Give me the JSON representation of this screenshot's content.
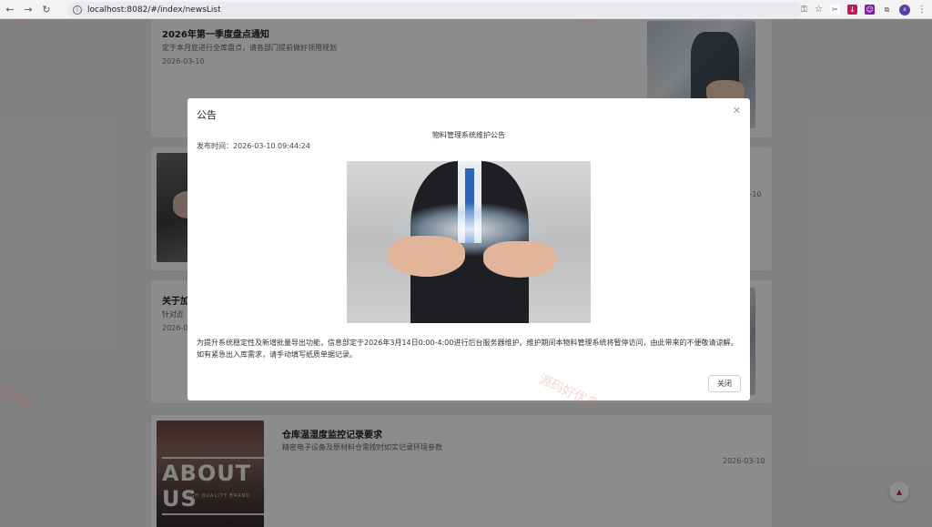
{
  "browser": {
    "url": "localhost:8082/#/index/newsList",
    "profile_initial": "x"
  },
  "news": [
    {
      "title": "2026年第一季度盘点通知",
      "desc": "定于本月底进行全库盘点，请各部门提前做好领用规划",
      "date": "2026-03-10"
    },
    {
      "title": "",
      "desc": "",
      "date": "2026-03-10"
    },
    {
      "title": "关于加",
      "desc": "针对近",
      "date": "2026-0"
    },
    {
      "title": "仓库温湿度监控记录要求",
      "desc": "精密电子设备及原材料仓需按时如实记录环境参数",
      "date": "2026-03-10",
      "thumb_text": "ABOUT US",
      "thumb_sub": "HIGH QUALITY BRAND"
    }
  ],
  "modal": {
    "title": "公告",
    "notice_title": "物料管理系统维护公告",
    "publish_label": "发布时间：",
    "publish_time": "2026-03-10 09:44:24",
    "body": "为提升系统稳定性及新增批量导出功能，信息部定于2026年3月14日0:00-4:00进行后台服务器维护。维护期间本物料管理系统将暂停访问，由此带来的不便敬请谅解。如有紧急出入库需求，请手动填写纸质单据记录。",
    "close_label": "关闭"
  },
  "watermark": "源码好优多"
}
